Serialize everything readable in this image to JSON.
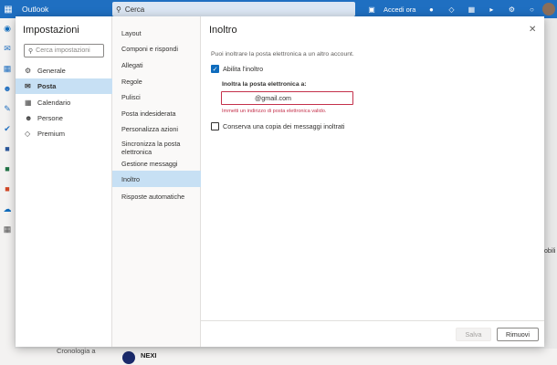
{
  "topbar": {
    "app_name": "Outlook",
    "search_placeholder": "Cerca",
    "signin_label": "Accedi ora",
    "icons": [
      "waffle-icon",
      "search-icon",
      "video-icon",
      "skype-icon",
      "diamond-icon",
      "calendar-add-icon",
      "megaphone-icon",
      "gear-icon",
      "lightbulb-icon",
      "avatar"
    ]
  },
  "rail_icons": [
    "outlook-icon",
    "mail-icon",
    "calendar-icon",
    "people-icon",
    "attach-icon",
    "todo-icon",
    "word-icon",
    "excel-icon",
    "powerpoint-icon",
    "onedrive-icon",
    "apps-icon"
  ],
  "background": {
    "folder_label": "Cronologia a",
    "sender": "NEXI",
    "right_text": "obili"
  },
  "settings": {
    "title": "Impostazioni",
    "search_placeholder": "Cerca impostazioni",
    "items": [
      {
        "label": "Generale",
        "icon": "gear-icon",
        "active": false
      },
      {
        "label": "Posta",
        "icon": "mail-icon",
        "active": true
      },
      {
        "label": "Calendario",
        "icon": "calendar-icon",
        "active": false
      },
      {
        "label": "Persone",
        "icon": "people-icon",
        "active": false
      },
      {
        "label": "Premium",
        "icon": "diamond-icon",
        "active": false
      }
    ]
  },
  "submenu": {
    "items": [
      {
        "label": "Layout",
        "active": false
      },
      {
        "label": "Componi e rispondi",
        "active": false
      },
      {
        "label": "Allegati",
        "active": false
      },
      {
        "label": "Regole",
        "active": false
      },
      {
        "label": "Pulisci",
        "active": false
      },
      {
        "label": "Posta indesiderata",
        "active": false
      },
      {
        "label": "Personalizza azioni",
        "active": false
      },
      {
        "label": "Sincronizza la posta elettronica",
        "active": false
      },
      {
        "label": "Gestione messaggi",
        "active": false
      },
      {
        "label": "Inoltro",
        "active": true
      },
      {
        "label": "Risposte automatiche",
        "active": false
      }
    ]
  },
  "forwarding": {
    "title": "Inoltro",
    "description": "Puoi inoltrare la posta elettronica a un altro account.",
    "enable_label": "Abilita l'inoltro",
    "enable_checked": true,
    "field_label": "Inoltra la posta elettronica a:",
    "email_value": "@gmail.com",
    "error_message": "Immetti un indirizzo di posta elettronica valido.",
    "keep_copy_label": "Conserva una copia dei messaggi inoltrati",
    "keep_copy_checked": false,
    "save_label": "Salva",
    "discard_label": "Rimuovi"
  },
  "colors": {
    "accent": "#1f6fc1",
    "selected_bg": "#c7e0f4",
    "error": "#c4314b"
  }
}
